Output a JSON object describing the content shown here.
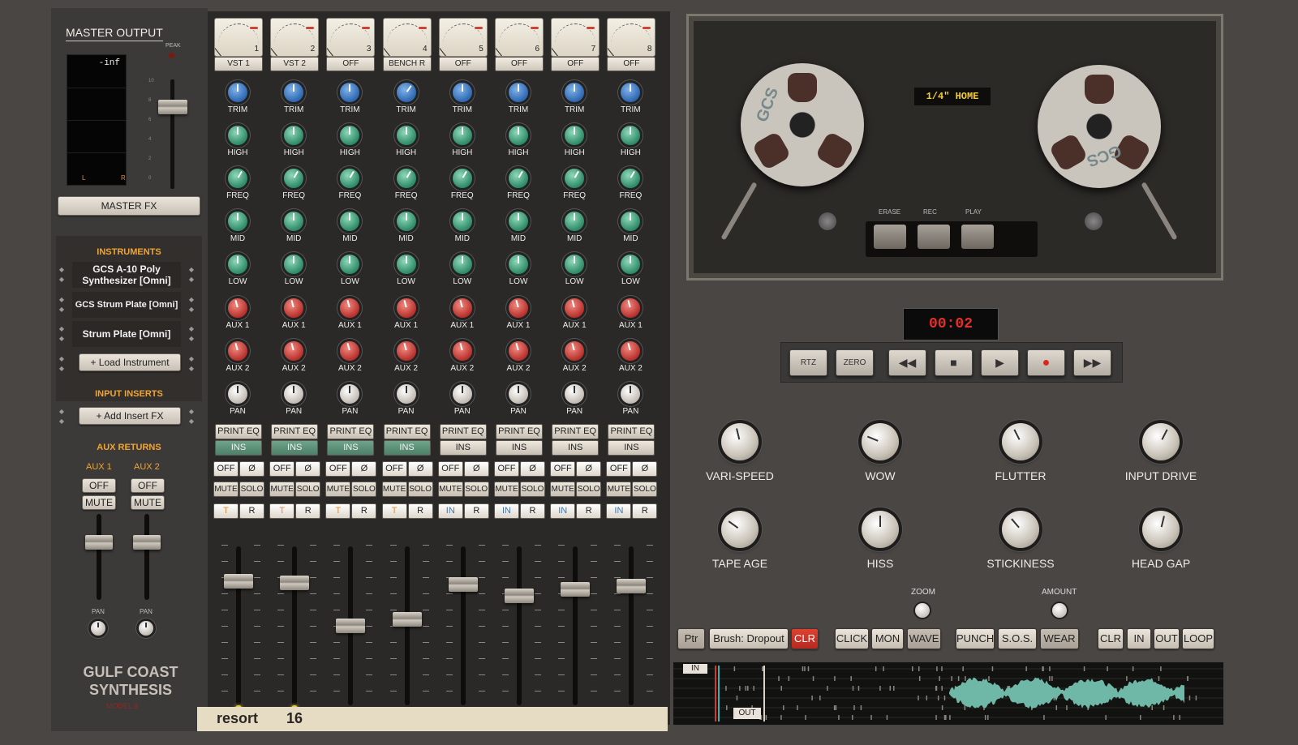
{
  "master": {
    "title": "MASTER OUTPUT",
    "peak_label": "PEAK",
    "meter_readout": "-inf",
    "meter_l": "L",
    "meter_r": "R",
    "fx_button": "MASTER FX",
    "scale": [
      "10",
      "8",
      "6",
      "4",
      "2",
      "0"
    ]
  },
  "instruments": {
    "header": "INSTRUMENTS",
    "items": [
      "GCS A-10 Poly Synthesizer [Omni]",
      "GCS Strum Plate [Omni]",
      "Strum Plate [Omni]"
    ],
    "load_button": "+ Load Instrument"
  },
  "inserts": {
    "header": "INPUT INSERTS",
    "add_button": "+ Add Insert FX"
  },
  "aux_returns": {
    "header": "AUX RETURNS",
    "aux1": "AUX 1",
    "aux2": "AUX 2",
    "off": "OFF",
    "mute": "MUTE",
    "pan": "PAN"
  },
  "brand": {
    "line1": "GULF COAST",
    "line2": "SYNTHESIS",
    "model": "MODEL 8"
  },
  "channels": [
    {
      "num": "1",
      "slot": "VST 1",
      "ins_active": true,
      "mode": "T",
      "fader": 0.78,
      "led": true
    },
    {
      "num": "2",
      "slot": "VST 2",
      "ins_active": true,
      "mode": "T",
      "fader": 0.77,
      "led": true
    },
    {
      "num": "3",
      "slot": "OFF",
      "ins_active": true,
      "mode": "T",
      "fader": 0.5,
      "led": false
    },
    {
      "num": "4",
      "slot": "BENCH R",
      "ins_active": true,
      "mode": "T",
      "fader": 0.54,
      "led": false
    },
    {
      "num": "5",
      "slot": "OFF",
      "ins_active": false,
      "mode": "IN",
      "fader": 0.76,
      "led": false
    },
    {
      "num": "6",
      "slot": "OFF",
      "ins_active": false,
      "mode": "IN",
      "fader": 0.69,
      "led": false
    },
    {
      "num": "7",
      "slot": "OFF",
      "ins_active": false,
      "mode": "IN",
      "fader": 0.73,
      "led": false
    },
    {
      "num": "8",
      "slot": "OFF",
      "ins_active": false,
      "mode": "IN",
      "fader": 0.75,
      "led": false
    }
  ],
  "strip_labels": {
    "trim": "TRIM",
    "high": "HIGH",
    "freq": "FREQ",
    "mid": "MID",
    "low": "LOW",
    "aux1": "AUX 1",
    "aux2": "AUX 2",
    "pan": "PAN",
    "print_eq": "PRINT EQ",
    "ins": "INS",
    "off": "OFF",
    "phase": "Ø",
    "mute": "MUTE",
    "solo": "SOLO",
    "r": "R"
  },
  "scribble": {
    "name": "resort",
    "number": "16"
  },
  "tape": {
    "display": "1/4\" HOME",
    "erase": "ERASE",
    "rec": "REC",
    "play": "PLAY",
    "reel_logo": "GCS"
  },
  "transport": {
    "counter": "00:02",
    "rtz": "RTZ",
    "zero": "ZERO"
  },
  "tape_knobs": [
    {
      "label": "VARI-SPEED",
      "value": 0.45
    },
    {
      "label": "WOW",
      "value": 0.25
    },
    {
      "label": "FLUTTER",
      "value": 0.4
    },
    {
      "label": "INPUT DRIVE",
      "value": 0.6
    },
    {
      "label": "TAPE AGE",
      "value": 0.3
    },
    {
      "label": "HISS",
      "value": 0.5
    },
    {
      "label": "STICKINESS",
      "value": 0.35
    },
    {
      "label": "HEAD GAP",
      "value": 0.55
    }
  ],
  "zoom_label": "ZOOM",
  "amount_label": "AMOUNT",
  "bottom_buttons": {
    "ptr": "Ptr",
    "brush": "Brush: Dropout",
    "clr1": "CLR",
    "click": "CLICK",
    "mon": "MON",
    "wave": "WAVE",
    "punch": "PUNCH",
    "sos": "S.O.S.",
    "wear": "WEAR",
    "clr2": "CLR",
    "in": "IN",
    "out": "OUT",
    "loop": "LOOP"
  },
  "waveform": {
    "in_marker": "IN",
    "out_marker": "OUT"
  },
  "colors": {
    "knob_blue": "#2f67b1",
    "knob_green": "#2e8a67",
    "knob_red": "#b8302c",
    "counter_red": "#e1302a",
    "accent_orange": "#f0a534",
    "wave_teal": "#6fb8a8"
  }
}
